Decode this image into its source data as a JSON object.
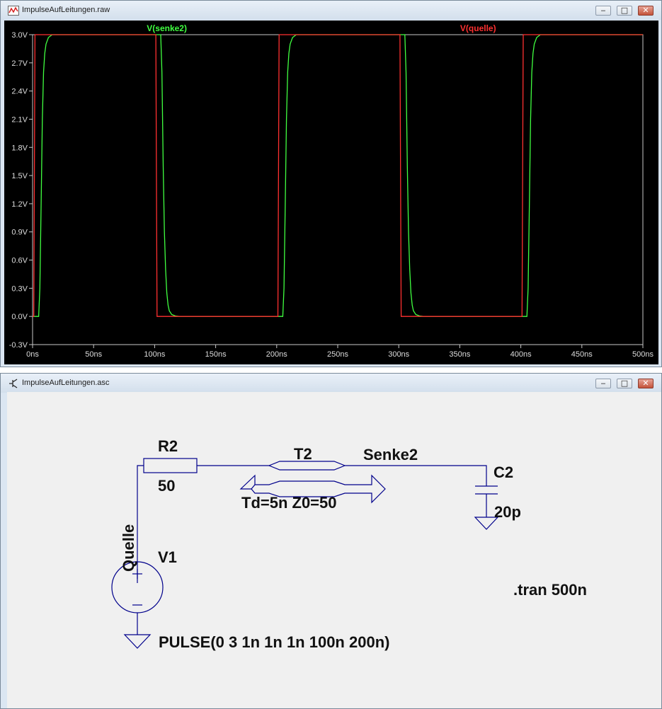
{
  "waveform_window": {
    "title": "ImpulseAufLeitungen.raw",
    "controls": {
      "minimize": "‒",
      "maximize": "□",
      "close": "✕"
    }
  },
  "schematic_window": {
    "title": "ImpulseAufLeitungen.asc",
    "controls": {
      "minimize": "‒",
      "maximize": "□",
      "close": "✕"
    }
  },
  "colors": {
    "plot_bg": "#000000",
    "plot_border": "#c8c8c8",
    "quelle": "#ff3030",
    "senke2": "#40ff40",
    "schematic_bg": "#f0f0f0",
    "wire": "#00008b"
  },
  "chart_data": {
    "type": "line",
    "xunit": "ns",
    "xlim": [
      0,
      500
    ],
    "ylim": [
      -0.3,
      3.0
    ],
    "grid": false,
    "x_ticks": [
      "0ns",
      "50ns",
      "100ns",
      "150ns",
      "200ns",
      "250ns",
      "300ns",
      "350ns",
      "400ns",
      "450ns",
      "500ns"
    ],
    "y_ticks": [
      "3.0V",
      "2.7V",
      "2.4V",
      "2.1V",
      "1.8V",
      "1.5V",
      "1.2V",
      "0.9V",
      "0.6V",
      "0.3V",
      "0.0V",
      "-0.3V"
    ],
    "series": [
      {
        "name": "V(senke2)",
        "color": "#40ff40",
        "x": [
          0,
          5,
          6,
          7,
          8,
          9,
          10,
          11,
          13,
          16,
          20,
          105,
          106,
          107,
          108,
          109,
          110,
          111,
          112,
          114,
          117,
          120,
          205,
          206,
          207,
          208,
          209,
          210,
          211,
          213,
          216,
          220,
          305,
          306,
          307,
          308,
          309,
          310,
          311,
          312,
          314,
          317,
          320,
          405,
          406,
          407,
          408,
          409,
          410,
          411,
          413,
          416,
          420,
          500
        ],
        "values": [
          0,
          0,
          0.3,
          1.2,
          2.1,
          2.6,
          2.8,
          2.9,
          2.97,
          3.0,
          3.0,
          3.0,
          2.6,
          1.6,
          0.9,
          0.5,
          0.25,
          0.12,
          0.06,
          0.02,
          0.005,
          0,
          0,
          0.3,
          1.2,
          2.1,
          2.6,
          2.8,
          2.9,
          2.97,
          3.0,
          3.0,
          3.0,
          2.6,
          1.6,
          0.9,
          0.5,
          0.25,
          0.12,
          0.06,
          0.02,
          0.005,
          0,
          0,
          0.3,
          1.2,
          2.1,
          2.6,
          2.8,
          2.9,
          2.97,
          3.0,
          3.0,
          3.0
        ]
      },
      {
        "name": "V(quelle)",
        "color": "#ff3030",
        "x": [
          0,
          1,
          2,
          101,
          102,
          201,
          202,
          301,
          302,
          401,
          402,
          500
        ],
        "values": [
          0,
          0,
          3.0,
          3.0,
          0,
          0,
          3.0,
          3.0,
          0,
          0,
          3.0,
          3.0
        ]
      }
    ]
  },
  "schematic": {
    "r2": {
      "name": "R2",
      "value": "50"
    },
    "t2": {
      "name": "T2",
      "value": "Td=5n Z0=50"
    },
    "net_senke": "Senke2",
    "net_quelle": "Quelle",
    "c2": {
      "name": "C2",
      "value": "20p"
    },
    "v1": {
      "name": "V1",
      "value": "PULSE(0 3 1n 1n 1n 100n 200n)"
    },
    "directive": ".tran 500n"
  }
}
